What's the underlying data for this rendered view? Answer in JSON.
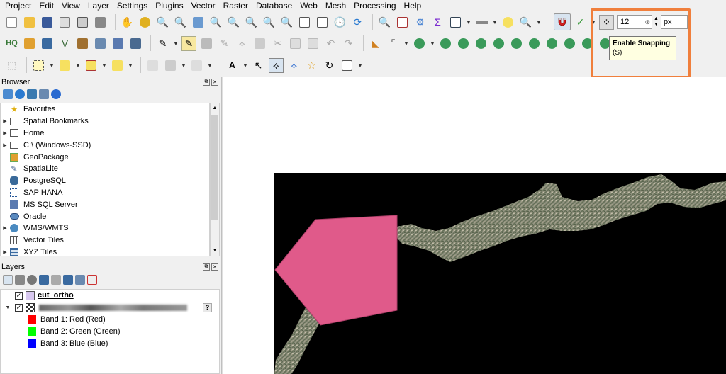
{
  "menubar": {
    "items": [
      "Project",
      "Edit",
      "View",
      "Layer",
      "Settings",
      "Plugins",
      "Vector",
      "Raster",
      "Database",
      "Web",
      "Mesh",
      "Processing",
      "Help"
    ]
  },
  "snapping_toolbar": {
    "tolerance_value": "12",
    "unit": "px"
  },
  "tooltip": {
    "title": "Enable Snapping",
    "shortcut": "(S)"
  },
  "browser_panel": {
    "title": "Browser",
    "items": [
      {
        "label": "Favorites",
        "icon": "star-icon",
        "expandable": false
      },
      {
        "label": "Spatial Bookmarks",
        "icon": "bookmark-icon",
        "expandable": true
      },
      {
        "label": "Home",
        "icon": "home-folder-icon",
        "expandable": true
      },
      {
        "label": "C:\\ (Windows-SSD)",
        "icon": "drive-icon",
        "expandable": true
      },
      {
        "label": "GeoPackage",
        "icon": "geopackage-icon",
        "expandable": false
      },
      {
        "label": "SpatiaLite",
        "icon": "spatialite-icon",
        "expandable": false
      },
      {
        "label": "PostgreSQL",
        "icon": "postgresql-icon",
        "expandable": false
      },
      {
        "label": "SAP HANA",
        "icon": "sap-hana-icon",
        "expandable": false
      },
      {
        "label": "MS SQL Server",
        "icon": "mssql-icon",
        "expandable": false
      },
      {
        "label": "Oracle",
        "icon": "oracle-icon",
        "expandable": false
      },
      {
        "label": "WMS/WMTS",
        "icon": "wms-icon",
        "expandable": true
      },
      {
        "label": "Vector Tiles",
        "icon": "vector-tiles-icon",
        "expandable": false
      },
      {
        "label": "XYZ Tiles",
        "icon": "xyz-tiles-icon",
        "expandable": true
      }
    ]
  },
  "layers_panel": {
    "title": "Layers",
    "layers": [
      {
        "label": "cut_ortho",
        "checked": true,
        "bold": true
      },
      {
        "label": "",
        "checked": true,
        "bold": false,
        "blurred": true
      }
    ],
    "bands": [
      {
        "label": "Band 1: Red (Red)",
        "color": "#ff0000"
      },
      {
        "label": "Band 2: Green (Green)",
        "color": "#00ff00"
      },
      {
        "label": "Band 3: Blue (Blue)",
        "color": "#0000ff"
      }
    ]
  },
  "colors": {
    "highlight": "#f07f3c",
    "polygon_fill": "#e05a8a",
    "tooltip_bg": "#ffffe1"
  }
}
